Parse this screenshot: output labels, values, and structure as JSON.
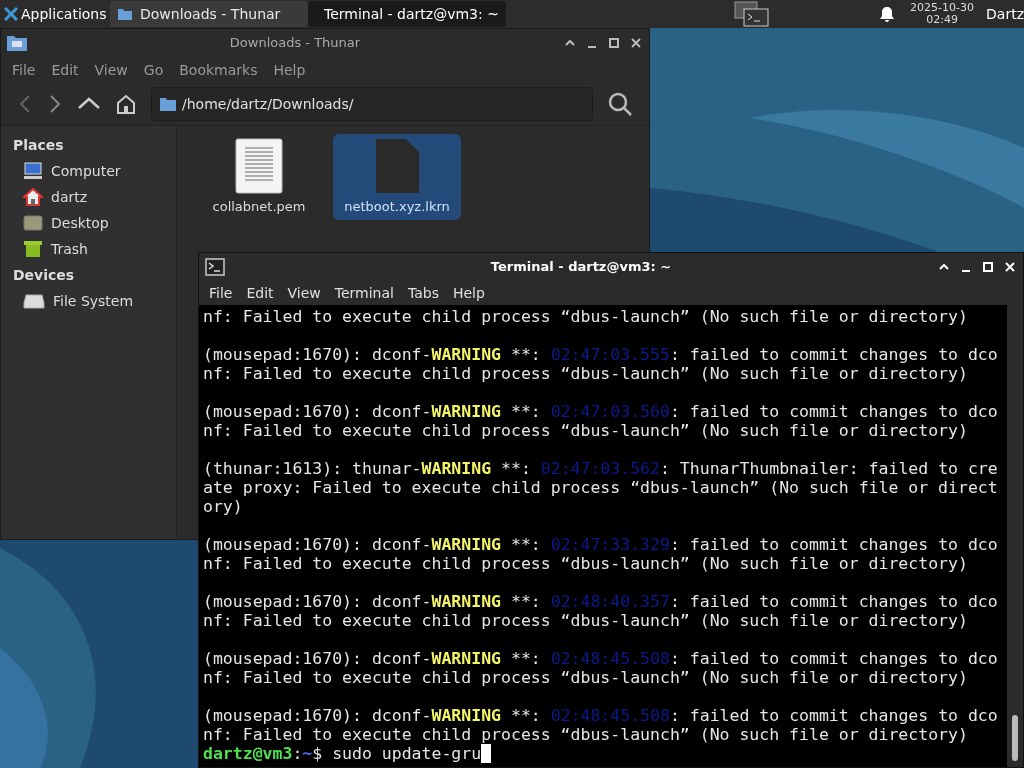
{
  "taskbar": {
    "apps_menu": "Applications",
    "tasks": [
      {
        "label": "Downloads - Thunar",
        "kind": "folder",
        "selected": false
      },
      {
        "label": "Terminal - dartz@vm3: ~",
        "kind": "terminal",
        "selected": true
      }
    ],
    "clock": {
      "date": "2025-10-30",
      "time": "02:49"
    },
    "user": "Dartz"
  },
  "file_manager": {
    "title": "Downloads - Thunar",
    "focused": false,
    "menu": [
      "File",
      "Edit",
      "View",
      "Go",
      "Bookmarks",
      "Help"
    ],
    "path": "/home/dartz/Downloads/",
    "sidebar": [
      {
        "heading": "Places",
        "items": [
          {
            "label": "Computer",
            "kind": "computer"
          },
          {
            "label": "dartz",
            "kind": "home"
          },
          {
            "label": "Desktop",
            "kind": "desktop"
          },
          {
            "label": "Trash",
            "kind": "trash"
          }
        ]
      },
      {
        "heading": "Devices",
        "items": [
          {
            "label": "File System",
            "kind": "drive"
          }
        ]
      }
    ],
    "files": [
      {
        "name": "collabnet.pem",
        "kind": "text",
        "selected": false
      },
      {
        "name": "netboot.xyz.lkrn",
        "kind": "binary",
        "selected": true
      }
    ]
  },
  "terminal": {
    "title": "Terminal - dartz@vm3: ~",
    "focused": true,
    "menu": [
      "File",
      "Edit",
      "View",
      "Terminal",
      "Tabs",
      "Help"
    ],
    "lines": [
      {
        "kind": "text",
        "segments": [
          {
            "kind": "plain",
            "text": "nf: Failed to execute child process “dbus-launch” (No such file or directory)"
          }
        ]
      },
      {
        "kind": "blank"
      },
      {
        "kind": "text",
        "segments": [
          {
            "kind": "plain",
            "text": "(mousepad:1670): dconf-"
          },
          {
            "kind": "warning",
            "text": "WARNING"
          },
          {
            "kind": "plain",
            "text": " **: "
          },
          {
            "kind": "timestamp",
            "text": "02:47:03.555"
          },
          {
            "kind": "plain",
            "text": ": failed to commit changes to dco"
          }
        ]
      },
      {
        "kind": "text",
        "segments": [
          {
            "kind": "plain",
            "text": "nf: Failed to execute child process “dbus-launch” (No such file or directory)"
          }
        ]
      },
      {
        "kind": "blank"
      },
      {
        "kind": "text",
        "segments": [
          {
            "kind": "plain",
            "text": "(mousepad:1670): dconf-"
          },
          {
            "kind": "warning",
            "text": "WARNING"
          },
          {
            "kind": "plain",
            "text": " **: "
          },
          {
            "kind": "timestamp",
            "text": "02:47:03.560"
          },
          {
            "kind": "plain",
            "text": ": failed to commit changes to dco"
          }
        ]
      },
      {
        "kind": "text",
        "segments": [
          {
            "kind": "plain",
            "text": "nf: Failed to execute child process “dbus-launch” (No such file or directory)"
          }
        ]
      },
      {
        "kind": "blank"
      },
      {
        "kind": "text",
        "segments": [
          {
            "kind": "plain",
            "text": "(thunar:1613): thunar-"
          },
          {
            "kind": "warning",
            "text": "WARNING"
          },
          {
            "kind": "plain",
            "text": " **: "
          },
          {
            "kind": "timestamp",
            "text": "02:47:03.562"
          },
          {
            "kind": "plain",
            "text": ": ThunarThumbnailer: failed to cre"
          }
        ]
      },
      {
        "kind": "text",
        "segments": [
          {
            "kind": "plain",
            "text": "ate proxy: Failed to execute child process “dbus-launch” (No such file or direct"
          }
        ]
      },
      {
        "kind": "text",
        "segments": [
          {
            "kind": "plain",
            "text": "ory)"
          }
        ]
      },
      {
        "kind": "blank"
      },
      {
        "kind": "text",
        "segments": [
          {
            "kind": "plain",
            "text": "(mousepad:1670): dconf-"
          },
          {
            "kind": "warning",
            "text": "WARNING"
          },
          {
            "kind": "plain",
            "text": " **: "
          },
          {
            "kind": "timestamp",
            "text": "02:47:33.329"
          },
          {
            "kind": "plain",
            "text": ": failed to commit changes to dco"
          }
        ]
      },
      {
        "kind": "text",
        "segments": [
          {
            "kind": "plain",
            "text": "nf: Failed to execute child process “dbus-launch” (No such file or directory)"
          }
        ]
      },
      {
        "kind": "blank"
      },
      {
        "kind": "text",
        "segments": [
          {
            "kind": "plain",
            "text": "(mousepad:1670): dconf-"
          },
          {
            "kind": "warning",
            "text": "WARNING"
          },
          {
            "kind": "plain",
            "text": " **: "
          },
          {
            "kind": "timestamp",
            "text": "02:48:40.357"
          },
          {
            "kind": "plain",
            "text": ": failed to commit changes to dco"
          }
        ]
      },
      {
        "kind": "text",
        "segments": [
          {
            "kind": "plain",
            "text": "nf: Failed to execute child process “dbus-launch” (No such file or directory)"
          }
        ]
      },
      {
        "kind": "blank"
      },
      {
        "kind": "text",
        "segments": [
          {
            "kind": "plain",
            "text": "(mousepad:1670): dconf-"
          },
          {
            "kind": "warning",
            "text": "WARNING"
          },
          {
            "kind": "plain",
            "text": " **: "
          },
          {
            "kind": "timestamp",
            "text": "02:48:45.508"
          },
          {
            "kind": "plain",
            "text": ": failed to commit changes to dco"
          }
        ]
      },
      {
        "kind": "text",
        "segments": [
          {
            "kind": "plain",
            "text": "nf: Failed to execute child process “dbus-launch” (No such file or directory)"
          }
        ]
      },
      {
        "kind": "blank"
      },
      {
        "kind": "text",
        "segments": [
          {
            "kind": "plain",
            "text": "(mousepad:1670): dconf-"
          },
          {
            "kind": "warning",
            "text": "WARNING"
          },
          {
            "kind": "plain",
            "text": " **: "
          },
          {
            "kind": "timestamp",
            "text": "02:48:45.508"
          },
          {
            "kind": "plain",
            "text": ": failed to commit changes to dco"
          }
        ]
      },
      {
        "kind": "text",
        "segments": [
          {
            "kind": "plain",
            "text": "nf: Failed to execute child process “dbus-launch” (No such file or directory)"
          }
        ]
      },
      {
        "kind": "text",
        "segments": [
          {
            "kind": "user",
            "text": "dartz@vm3"
          },
          {
            "kind": "plain",
            "text": ":"
          },
          {
            "kind": "path",
            "text": "~"
          },
          {
            "kind": "plain",
            "text": "$ sudo update-gru"
          }
        ],
        "cursor": true
      }
    ]
  }
}
